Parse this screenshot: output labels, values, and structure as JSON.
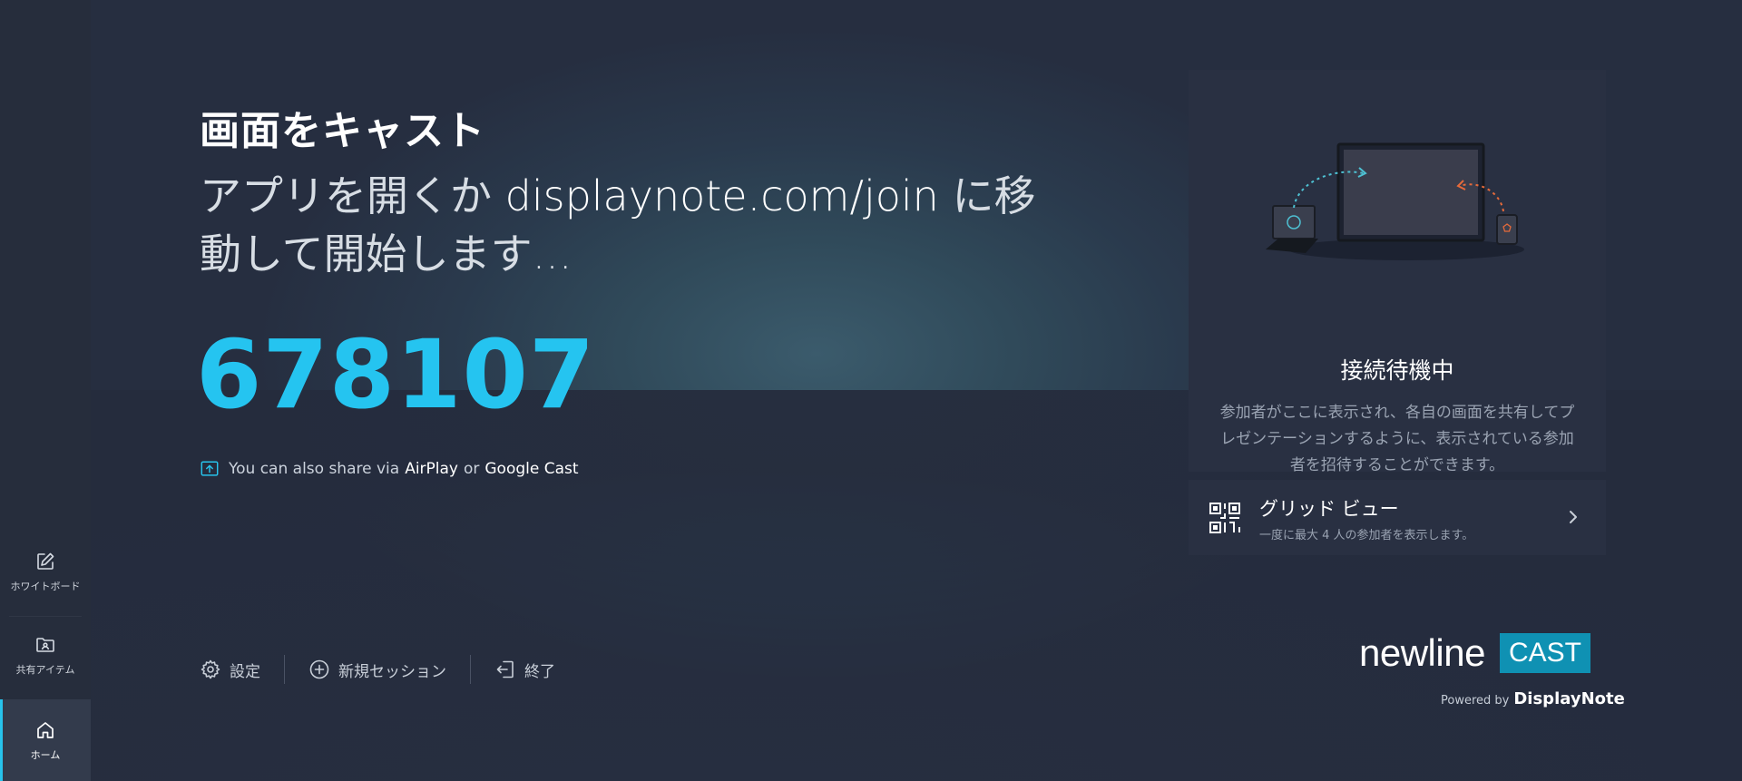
{
  "sidebar": {
    "items": [
      {
        "label": "ホワイトボード",
        "icon": "edit-icon"
      },
      {
        "label": "共有アイテム",
        "icon": "shared-folder-icon"
      },
      {
        "label": "ホーム",
        "icon": "home-icon",
        "active": true
      }
    ]
  },
  "main": {
    "title": "画面をキャスト",
    "instruction_before": "アプリを開くか ",
    "instruction_url": "displaynote.com/join",
    "instruction_after": " に移動して開始します...",
    "session_code": "678107",
    "share_prefix": "You can also share via",
    "share_airplay": "AirPlay",
    "share_or": "or",
    "share_google": "Google Cast"
  },
  "actions": {
    "settings": "設定",
    "new_session": "新規セッション",
    "exit": "終了"
  },
  "panel": {
    "title": "接続待機中",
    "description": "参加者がここに表示され、各自の画面を共有してプレゼンテーションするように、表示されている参加者を招待することができます。"
  },
  "grid_view": {
    "title": "グリッド ビュー",
    "subtitle": "一度に最大 4 人の参加者を表示します。"
  },
  "branding": {
    "newline": "newline",
    "cast": "CAST",
    "powered_by": "Powered by",
    "displaynote": "DisplayNote"
  },
  "colors": {
    "accent": "#25c4f0",
    "cast_badge": "#0f91b3"
  }
}
